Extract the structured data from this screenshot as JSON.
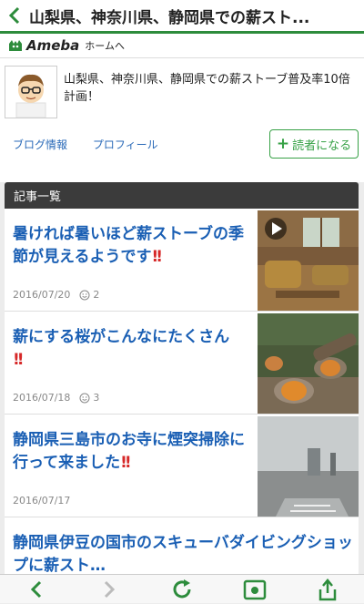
{
  "header": {
    "title": "山梨県、神奈川県、静岡県での薪スト..."
  },
  "ameba": {
    "logo": "Ameba",
    "home_link": "ホームへ"
  },
  "blog": {
    "title": "山梨県、神奈川県、静岡県での薪ストーブ普及率10倍計画！",
    "links": [
      "ブログ情報",
      "プロフィール"
    ],
    "follow_label": "読者になる"
  },
  "list": {
    "header": "記事一覧",
    "articles": [
      {
        "title": "暑ければ暑いほど薪ストーブの季節が見えるようです",
        "date": "2016/07/20",
        "likes": "2",
        "thumb": "video-room"
      },
      {
        "title": "薪にする桜がこんなにたくさん",
        "date": "2016/07/18",
        "likes": "3",
        "thumb": "logs"
      },
      {
        "title": "静岡県三島市のお寺に煙突掃除に行って来ました",
        "date": "2016/07/17",
        "likes": "",
        "thumb": "fog"
      },
      {
        "title": "静岡県伊豆の国市のスキューバダイビングショップに薪スト…",
        "date": "",
        "likes": "",
        "thumb": ""
      }
    ]
  },
  "toolbar": {
    "icons": [
      "back-icon",
      "forward-icon",
      "reload-icon",
      "bookmark-icon",
      "share-icon"
    ]
  },
  "colors": {
    "accent_green": "#2d8c3c",
    "link_blue": "#1a5fb4",
    "exclaim_red": "#d62828"
  }
}
